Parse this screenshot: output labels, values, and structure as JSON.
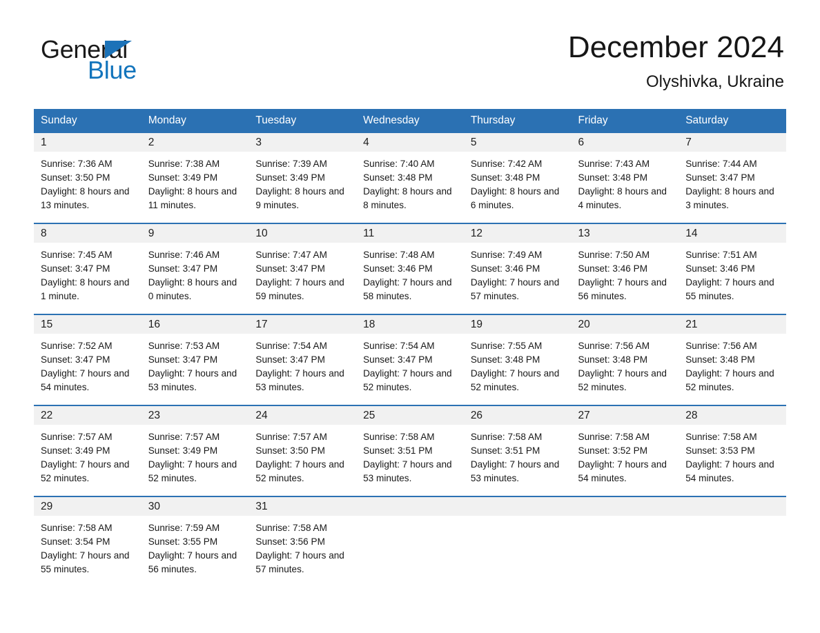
{
  "brand": {
    "name_part1": "General",
    "name_part2": "Blue",
    "logo_icon": "triangle-flag-icon",
    "accent_color": "#1b72b8"
  },
  "header": {
    "title": "December 2024",
    "location": "Olyshivka, Ukraine"
  },
  "colors": {
    "header_blue": "#2b71b3",
    "date_band_gray": "#f1f1f1",
    "cell_white": "#ffffff",
    "text_black": "#181818",
    "logo_blue": "#1274bc"
  },
  "calendar": {
    "weekday_headers": [
      "Sunday",
      "Monday",
      "Tuesday",
      "Wednesday",
      "Thursday",
      "Friday",
      "Saturday"
    ],
    "weeks": [
      [
        {
          "date": "1",
          "sunrise": "Sunrise: 7:36 AM",
          "sunset": "Sunset: 3:50 PM",
          "daylight": "Daylight: 8 hours and 13 minutes."
        },
        {
          "date": "2",
          "sunrise": "Sunrise: 7:38 AM",
          "sunset": "Sunset: 3:49 PM",
          "daylight": "Daylight: 8 hours and 11 minutes."
        },
        {
          "date": "3",
          "sunrise": "Sunrise: 7:39 AM",
          "sunset": "Sunset: 3:49 PM",
          "daylight": "Daylight: 8 hours and 9 minutes."
        },
        {
          "date": "4",
          "sunrise": "Sunrise: 7:40 AM",
          "sunset": "Sunset: 3:48 PM",
          "daylight": "Daylight: 8 hours and 8 minutes."
        },
        {
          "date": "5",
          "sunrise": "Sunrise: 7:42 AM",
          "sunset": "Sunset: 3:48 PM",
          "daylight": "Daylight: 8 hours and 6 minutes."
        },
        {
          "date": "6",
          "sunrise": "Sunrise: 7:43 AM",
          "sunset": "Sunset: 3:48 PM",
          "daylight": "Daylight: 8 hours and 4 minutes."
        },
        {
          "date": "7",
          "sunrise": "Sunrise: 7:44 AM",
          "sunset": "Sunset: 3:47 PM",
          "daylight": "Daylight: 8 hours and 3 minutes."
        }
      ],
      [
        {
          "date": "8",
          "sunrise": "Sunrise: 7:45 AM",
          "sunset": "Sunset: 3:47 PM",
          "daylight": "Daylight: 8 hours and 1 minute."
        },
        {
          "date": "9",
          "sunrise": "Sunrise: 7:46 AM",
          "sunset": "Sunset: 3:47 PM",
          "daylight": "Daylight: 8 hours and 0 minutes."
        },
        {
          "date": "10",
          "sunrise": "Sunrise: 7:47 AM",
          "sunset": "Sunset: 3:47 PM",
          "daylight": "Daylight: 7 hours and 59 minutes."
        },
        {
          "date": "11",
          "sunrise": "Sunrise: 7:48 AM",
          "sunset": "Sunset: 3:46 PM",
          "daylight": "Daylight: 7 hours and 58 minutes."
        },
        {
          "date": "12",
          "sunrise": "Sunrise: 7:49 AM",
          "sunset": "Sunset: 3:46 PM",
          "daylight": "Daylight: 7 hours and 57 minutes."
        },
        {
          "date": "13",
          "sunrise": "Sunrise: 7:50 AM",
          "sunset": "Sunset: 3:46 PM",
          "daylight": "Daylight: 7 hours and 56 minutes."
        },
        {
          "date": "14",
          "sunrise": "Sunrise: 7:51 AM",
          "sunset": "Sunset: 3:46 PM",
          "daylight": "Daylight: 7 hours and 55 minutes."
        }
      ],
      [
        {
          "date": "15",
          "sunrise": "Sunrise: 7:52 AM",
          "sunset": "Sunset: 3:47 PM",
          "daylight": "Daylight: 7 hours and 54 minutes."
        },
        {
          "date": "16",
          "sunrise": "Sunrise: 7:53 AM",
          "sunset": "Sunset: 3:47 PM",
          "daylight": "Daylight: 7 hours and 53 minutes."
        },
        {
          "date": "17",
          "sunrise": "Sunrise: 7:54 AM",
          "sunset": "Sunset: 3:47 PM",
          "daylight": "Daylight: 7 hours and 53 minutes."
        },
        {
          "date": "18",
          "sunrise": "Sunrise: 7:54 AM",
          "sunset": "Sunset: 3:47 PM",
          "daylight": "Daylight: 7 hours and 52 minutes."
        },
        {
          "date": "19",
          "sunrise": "Sunrise: 7:55 AM",
          "sunset": "Sunset: 3:48 PM",
          "daylight": "Daylight: 7 hours and 52 minutes."
        },
        {
          "date": "20",
          "sunrise": "Sunrise: 7:56 AM",
          "sunset": "Sunset: 3:48 PM",
          "daylight": "Daylight: 7 hours and 52 minutes."
        },
        {
          "date": "21",
          "sunrise": "Sunrise: 7:56 AM",
          "sunset": "Sunset: 3:48 PM",
          "daylight": "Daylight: 7 hours and 52 minutes."
        }
      ],
      [
        {
          "date": "22",
          "sunrise": "Sunrise: 7:57 AM",
          "sunset": "Sunset: 3:49 PM",
          "daylight": "Daylight: 7 hours and 52 minutes."
        },
        {
          "date": "23",
          "sunrise": "Sunrise: 7:57 AM",
          "sunset": "Sunset: 3:49 PM",
          "daylight": "Daylight: 7 hours and 52 minutes."
        },
        {
          "date": "24",
          "sunrise": "Sunrise: 7:57 AM",
          "sunset": "Sunset: 3:50 PM",
          "daylight": "Daylight: 7 hours and 52 minutes."
        },
        {
          "date": "25",
          "sunrise": "Sunrise: 7:58 AM",
          "sunset": "Sunset: 3:51 PM",
          "daylight": "Daylight: 7 hours and 53 minutes."
        },
        {
          "date": "26",
          "sunrise": "Sunrise: 7:58 AM",
          "sunset": "Sunset: 3:51 PM",
          "daylight": "Daylight: 7 hours and 53 minutes."
        },
        {
          "date": "27",
          "sunrise": "Sunrise: 7:58 AM",
          "sunset": "Sunset: 3:52 PM",
          "daylight": "Daylight: 7 hours and 54 minutes."
        },
        {
          "date": "28",
          "sunrise": "Sunrise: 7:58 AM",
          "sunset": "Sunset: 3:53 PM",
          "daylight": "Daylight: 7 hours and 54 minutes."
        }
      ],
      [
        {
          "date": "29",
          "sunrise": "Sunrise: 7:58 AM",
          "sunset": "Sunset: 3:54 PM",
          "daylight": "Daylight: 7 hours and 55 minutes."
        },
        {
          "date": "30",
          "sunrise": "Sunrise: 7:59 AM",
          "sunset": "Sunset: 3:55 PM",
          "daylight": "Daylight: 7 hours and 56 minutes."
        },
        {
          "date": "31",
          "sunrise": "Sunrise: 7:58 AM",
          "sunset": "Sunset: 3:56 PM",
          "daylight": "Daylight: 7 hours and 57 minutes."
        },
        {
          "date": "",
          "sunrise": "",
          "sunset": "",
          "daylight": ""
        },
        {
          "date": "",
          "sunrise": "",
          "sunset": "",
          "daylight": ""
        },
        {
          "date": "",
          "sunrise": "",
          "sunset": "",
          "daylight": ""
        },
        {
          "date": "",
          "sunrise": "",
          "sunset": "",
          "daylight": ""
        }
      ]
    ]
  }
}
